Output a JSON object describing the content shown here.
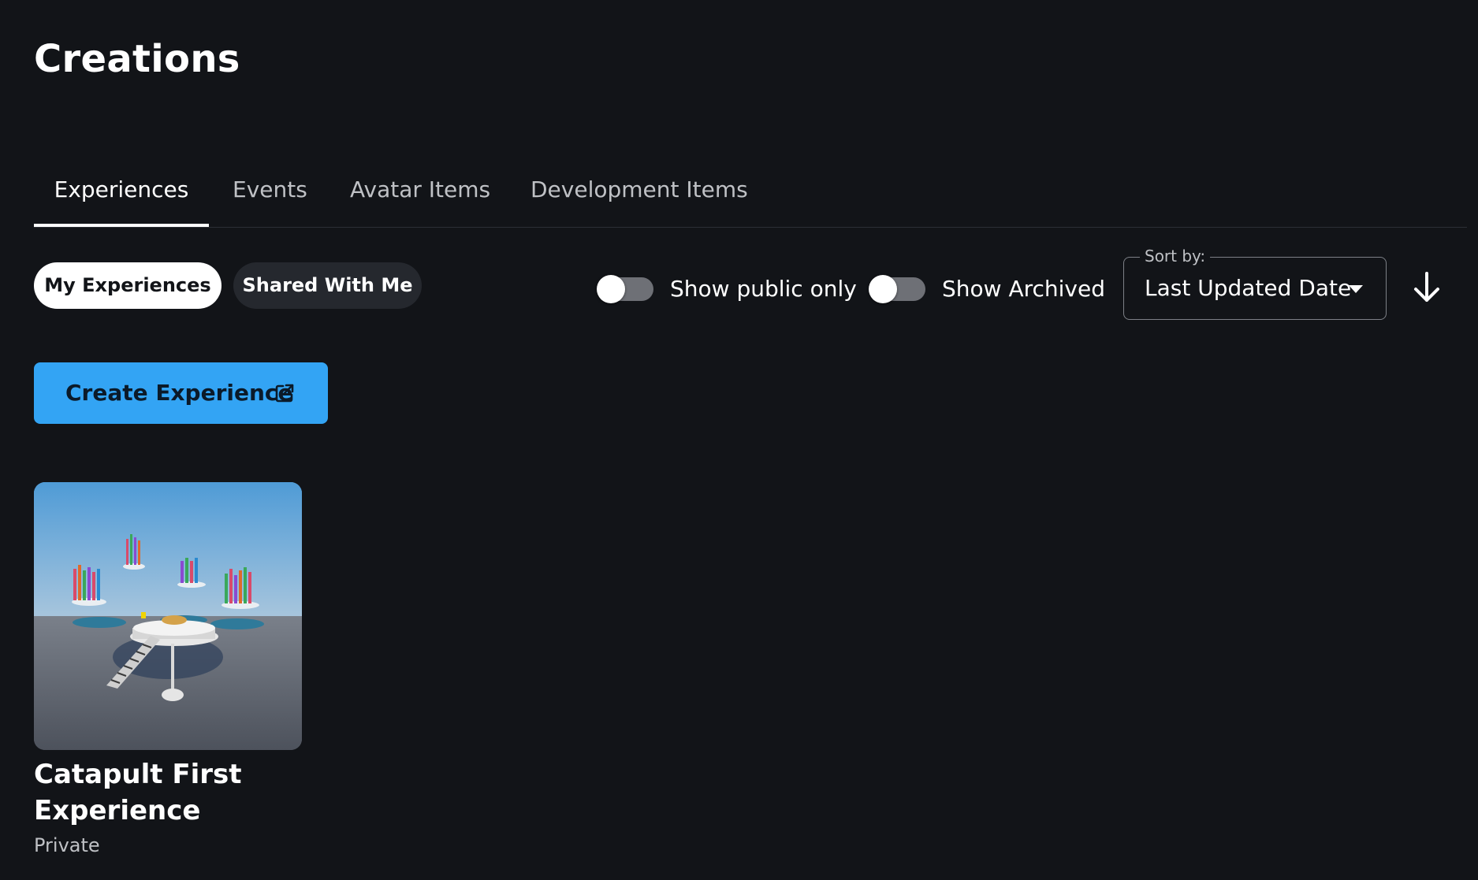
{
  "page": {
    "title": "Creations"
  },
  "tabs": [
    {
      "label": "Experiences",
      "active": true
    },
    {
      "label": "Events",
      "active": false
    },
    {
      "label": "Avatar Items",
      "active": false
    },
    {
      "label": "Development Items",
      "active": false
    }
  ],
  "filters": {
    "my_experiences": "My Experiences",
    "shared_with_me": "Shared With Me",
    "show_public_only": {
      "label": "Show public only",
      "on": false
    },
    "show_archived": {
      "label": "Show Archived",
      "on": false
    }
  },
  "sort": {
    "legend": "Sort by:",
    "value": "Last Updated Date",
    "direction_icon": "arrow-down-icon"
  },
  "actions": {
    "create_label": "Create Experience",
    "create_icon": "external-link-icon"
  },
  "experiences": [
    {
      "title": "Catapult First Experience",
      "status": "Private"
    }
  ],
  "colors": {
    "background": "#121418",
    "accent": "#33a4f4",
    "pill_inactive": "#25282e",
    "muted_text": "#bfc1c5"
  }
}
